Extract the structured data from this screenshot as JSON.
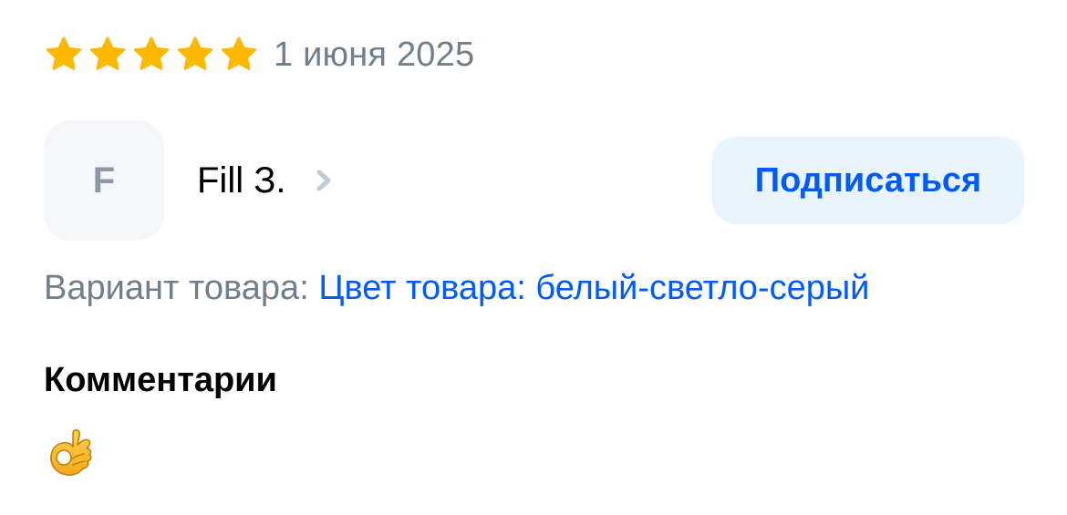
{
  "review": {
    "rating": 5,
    "rating_max": 5,
    "date": "1 июня 2025",
    "author": {
      "initial": "F",
      "name": "Fill З."
    },
    "subscribe_label": "Подписаться",
    "variant": {
      "label": "Вариант товара:",
      "value": "Цвет товара: белый-светло-серый"
    },
    "comments_heading": "Комментарии",
    "comment_emoji": "ok-hand-emoji"
  },
  "colors": {
    "star": "#ffb800",
    "accent": "#005bff",
    "button_bg": "#e8f4fe",
    "muted_text": "#707f8d",
    "avatar_bg": "#f4f6fa",
    "chevron": "#c4cad3"
  },
  "icons": {
    "star": "star-icon",
    "chevron": "chevron-right-icon"
  }
}
